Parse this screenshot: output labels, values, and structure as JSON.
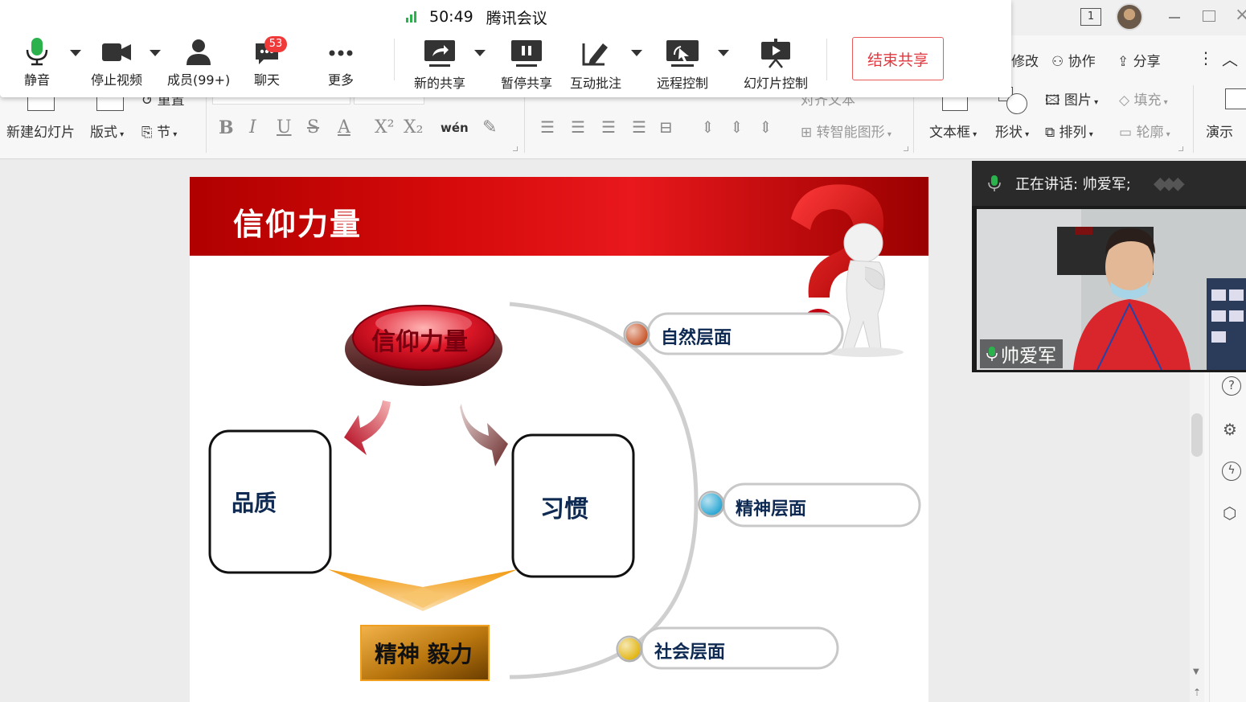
{
  "meeting": {
    "time": "50:49",
    "app_title": "腾讯会议",
    "tools": {
      "mute": "静音",
      "stop_video": "停止视频",
      "members": "成员(99+)",
      "chat": "聊天",
      "chat_badge": "53",
      "more": "更多",
      "new_share": "新的共享",
      "pause_share": "暂停共享",
      "annotate": "互动批注",
      "remote_control": "远程控制",
      "slideshow_control": "幻灯片控制"
    },
    "end_share": "结束共享"
  },
  "wps": {
    "window_badge": "1",
    "edit": "修改",
    "collaborate": "协作",
    "share": "分享",
    "reset": "重置",
    "new_slide": "新建幻灯片",
    "layout": "版式",
    "section": "节",
    "pinyin": "wén",
    "align_text": "对齐文本",
    "smart_art": "转智能图形",
    "text_box": "文本框",
    "shape": "形状",
    "picture": "图片",
    "fill": "填充",
    "arrange": "排列",
    "outline": "轮廓",
    "present": "演示"
  },
  "slide": {
    "title": "信仰力量",
    "button_text": "信仰力量",
    "quality": "品质",
    "habit": "习惯",
    "spirit": "精神 毅力",
    "levels": [
      "自然层面",
      "精神层面",
      "社会层面"
    ],
    "level_colors": [
      "#c44a1a",
      "#1aa0d0",
      "#e0b000"
    ]
  },
  "video": {
    "speaking": "正在讲话: 帅爱军;",
    "name": "帅爱军"
  },
  "colors": {
    "accent_red": "#e0383e",
    "mic_green": "#2bb24c"
  }
}
